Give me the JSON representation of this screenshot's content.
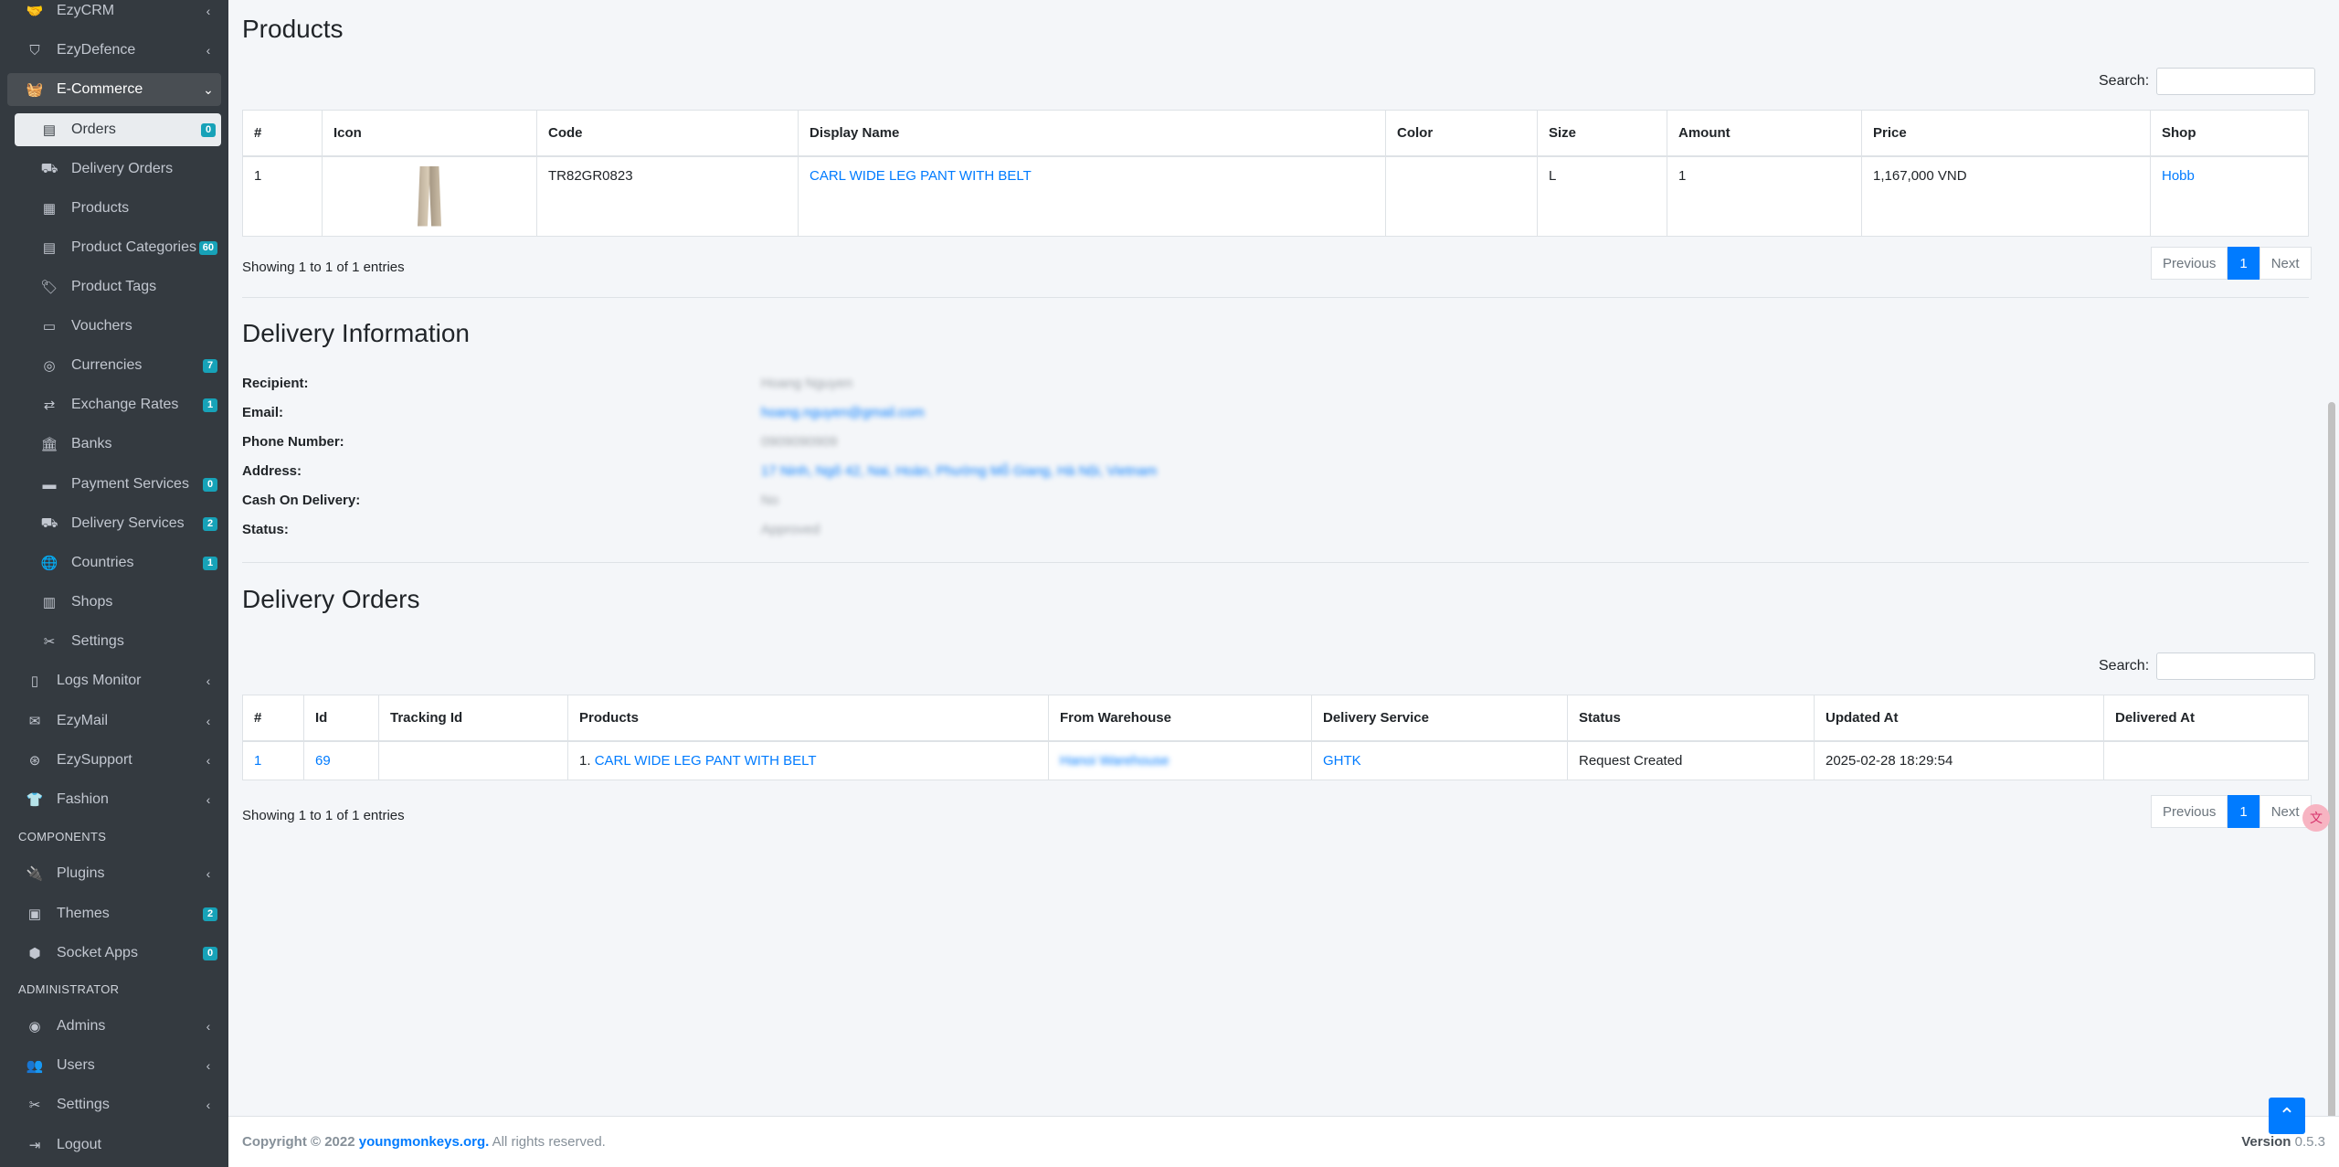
{
  "sidebar": {
    "items": [
      {
        "label": "EzyCRM",
        "icon": "handshake-icon"
      },
      {
        "label": "EzyDefence",
        "icon": "shield-icon"
      },
      {
        "label": "E-Commerce",
        "icon": "basket-icon"
      },
      {
        "label": "Orders",
        "icon": "clipboard-icon",
        "badge": "0"
      },
      {
        "label": "Delivery Orders",
        "icon": "truck-loading-icon"
      },
      {
        "label": "Products",
        "icon": "boxes-icon"
      },
      {
        "label": "Product Categories",
        "icon": "clipboard-list-icon",
        "badge": "60"
      },
      {
        "label": "Product Tags",
        "icon": "tags-icon"
      },
      {
        "label": "Vouchers",
        "icon": "ticket-icon"
      },
      {
        "label": "Currencies",
        "icon": "coins-icon",
        "badge": "7"
      },
      {
        "label": "Exchange Rates",
        "icon": "exchange-icon",
        "badge": "1"
      },
      {
        "label": "Banks",
        "icon": "bank-icon"
      },
      {
        "label": "Payment Services",
        "icon": "credit-card-icon",
        "badge": "0"
      },
      {
        "label": "Delivery Services",
        "icon": "truck-icon",
        "badge": "2"
      },
      {
        "label": "Countries",
        "icon": "globe-icon",
        "badge": "1"
      },
      {
        "label": "Shops",
        "icon": "store-icon"
      },
      {
        "label": "Settings",
        "icon": "tools-icon"
      },
      {
        "label": "Logs Monitor",
        "icon": "file-icon"
      },
      {
        "label": "EzyMail",
        "icon": "envelope-icon"
      },
      {
        "label": "EzySupport",
        "icon": "life-ring-icon"
      },
      {
        "label": "Fashion",
        "icon": "tshirt-icon"
      },
      {
        "label": "Plugins",
        "icon": "plug-icon"
      },
      {
        "label": "Themes",
        "icon": "window-icon",
        "badge": "2"
      },
      {
        "label": "Socket Apps",
        "icon": "cubes-icon",
        "badge": "0"
      },
      {
        "label": "Admins",
        "icon": "user-circle-icon"
      },
      {
        "label": "Users",
        "icon": "users-icon"
      },
      {
        "label": "Settings",
        "icon": "tools-icon"
      },
      {
        "label": "Logout",
        "icon": "logout-icon"
      }
    ],
    "headers": {
      "components": "COMPONENTS",
      "administrator": "ADMINISTRATOR"
    }
  },
  "products": {
    "title": "Products",
    "search_label": "Search:",
    "columns": [
      "#",
      "Icon",
      "Code",
      "Display Name",
      "Color",
      "Size",
      "Amount",
      "Price",
      "Shop"
    ],
    "rows": [
      {
        "num": "1",
        "code": "TR82GR0823",
        "display_name": "CARL WIDE LEG PANT WITH BELT",
        "color": "",
        "size": "L",
        "amount": "1",
        "price": "1,167,000 VND",
        "shop": "Hobb"
      }
    ],
    "showing": "Showing 1 to 1 of 1 entries",
    "pager": {
      "prev": "Previous",
      "page": "1",
      "next": "Next"
    }
  },
  "delivery_info": {
    "title": "Delivery Information",
    "fields": [
      {
        "label": "Recipient:",
        "value": "Hoang Nguyen"
      },
      {
        "label": "Email:",
        "value": "hoang.nguyen@gmail.com"
      },
      {
        "label": "Phone Number:",
        "value": "0909090909"
      },
      {
        "label": "Address:",
        "value": "17 Ninh, Ngõ 42, Nai, Hoàn, Phường Mỗ Giang, Hà Nội, Vietnam"
      },
      {
        "label": "Cash On Delivery:",
        "value": "No"
      },
      {
        "label": "Status:",
        "value": "Approved"
      }
    ]
  },
  "delivery_orders": {
    "title": "Delivery Orders",
    "search_label": "Search:",
    "columns": [
      "#",
      "Id",
      "Tracking Id",
      "Products",
      "From Warehouse",
      "Delivery Service",
      "Status",
      "Updated At",
      "Delivered At"
    ],
    "rows": [
      {
        "num": "1",
        "id": "69",
        "tracking_id": "",
        "product_prefix": "1.",
        "product": "CARL WIDE LEG PANT WITH BELT",
        "warehouse": "Hanoi Warehouse",
        "service": "GHTK",
        "status": "Request Created",
        "updated_at": "2025-02-28 18:29:54",
        "delivered_at": ""
      }
    ],
    "showing": "Showing 1 to 1 of 1 entries",
    "pager": {
      "prev": "Previous",
      "page": "1",
      "next": "Next"
    }
  },
  "footer": {
    "copyright": "Copyright © 2022",
    "org": "youngmonkeys.org.",
    "rights": "All rights reserved.",
    "version_label": "Version",
    "version": "0.5.3"
  }
}
